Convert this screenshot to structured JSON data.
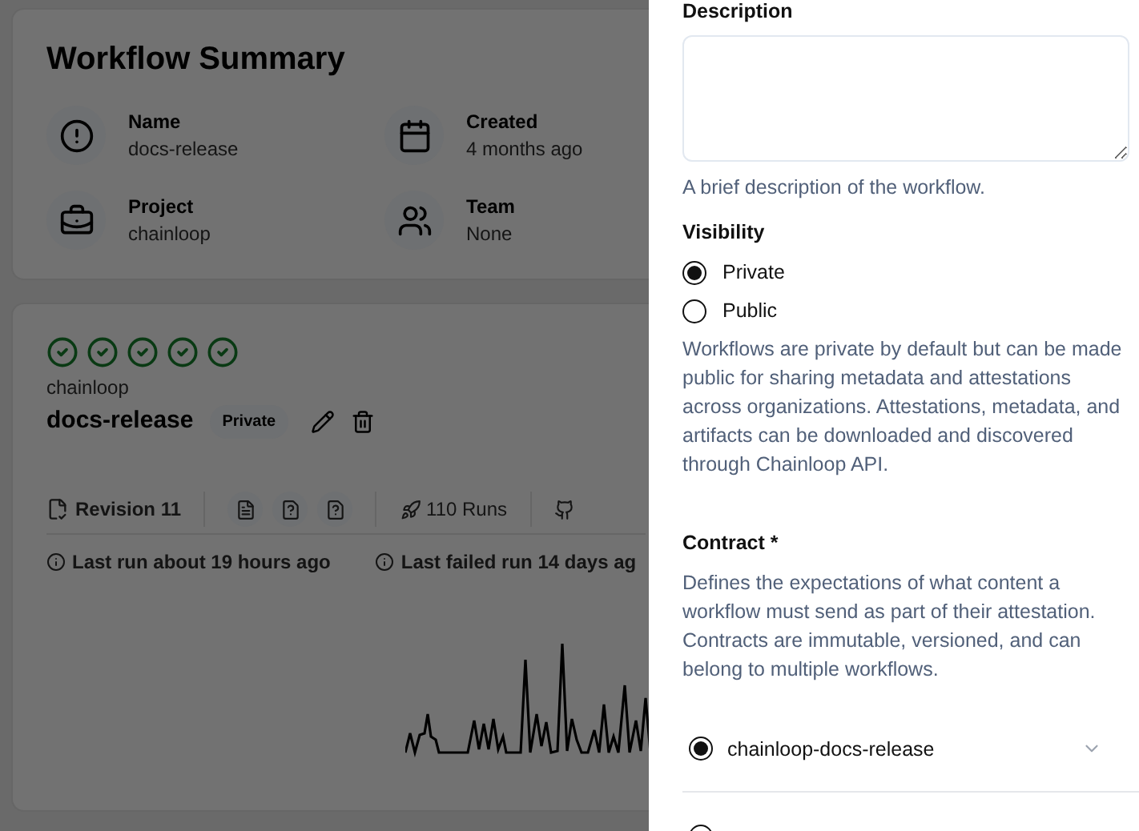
{
  "summary": {
    "title": "Workflow Summary",
    "fields": [
      {
        "label": "Name",
        "value": "docs-release"
      },
      {
        "label": "Created",
        "value": "4 months ago"
      },
      {
        "label": "Project",
        "value": "chainloop"
      },
      {
        "label": "Team",
        "value": "None"
      }
    ]
  },
  "workflow": {
    "runs": [
      {
        "passed": true
      },
      {
        "passed": true
      },
      {
        "passed": true
      },
      {
        "passed": true
      },
      {
        "passed": true
      }
    ],
    "project": "chainloop",
    "name": "docs-release",
    "visibility_badge": "Private",
    "revision": "Revision 11",
    "runs_count": "110 Runs",
    "last_run": "Last run about 19 hours ago",
    "last_failed_run": "Last failed run 14 days ag"
  },
  "sheet": {
    "description": {
      "label": "Description",
      "hint": "A brief description of the workflow."
    },
    "visibility": {
      "label": "Visibility",
      "options": [
        {
          "label": "Private",
          "selected": true
        },
        {
          "label": "Public",
          "selected": false
        }
      ],
      "help": "Workflows are private by default but can be made public for sharing metadata and attestations across organizations. Attestations, metadata, and artifacts can be downloaded and discovered through Chainloop API."
    },
    "contract": {
      "label": "Contract *",
      "help": "Defines the expectations of what content a workflow must send as part of their attestation. Contracts are immutable, versioned, and can belong to multiple workflows.",
      "options": [
        {
          "label": "chainloop-docs-release",
          "selected": true
        },
        {
          "selected": false
        }
      ]
    }
  }
}
